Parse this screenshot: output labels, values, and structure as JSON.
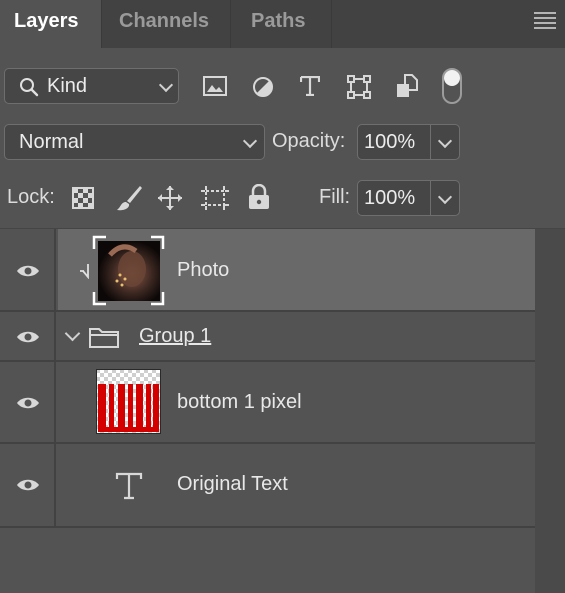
{
  "tabs": [
    {
      "label": "Layers",
      "active": true
    },
    {
      "label": "Channels",
      "active": false
    },
    {
      "label": "Paths",
      "active": false
    }
  ],
  "filter": {
    "kind_label": "Kind",
    "filter_icons": [
      "image-filter-icon",
      "adjustment-filter-icon",
      "type-filter-icon",
      "shape-filter-icon",
      "smart-object-filter-icon"
    ],
    "toggle_on": true
  },
  "blend": {
    "mode": "Normal",
    "opacity_label": "Opacity:",
    "opacity_value": "100%"
  },
  "lock": {
    "label": "Lock:",
    "icons": [
      "lock-transparent-pixels-icon",
      "lock-image-pixels-icon",
      "lock-position-icon",
      "lock-artboard-icon",
      "lock-all-icon"
    ],
    "fill_label": "Fill:",
    "fill_value": "100%"
  },
  "layers": [
    {
      "name": "Photo",
      "visible": true,
      "clipped": true,
      "selected": true,
      "type": "smart-object"
    },
    {
      "name": "Group 1",
      "visible": true,
      "type": "group",
      "expanded": true
    },
    {
      "name": "bottom 1 pixel",
      "visible": true,
      "type": "pixel"
    },
    {
      "name": "Original Text",
      "visible": true,
      "type": "text"
    }
  ],
  "colors": {
    "panel_bg": "#535353",
    "tab_bar_bg": "#424242",
    "selected_row": "#6b6b6b",
    "stripe_red": "#d40000"
  }
}
